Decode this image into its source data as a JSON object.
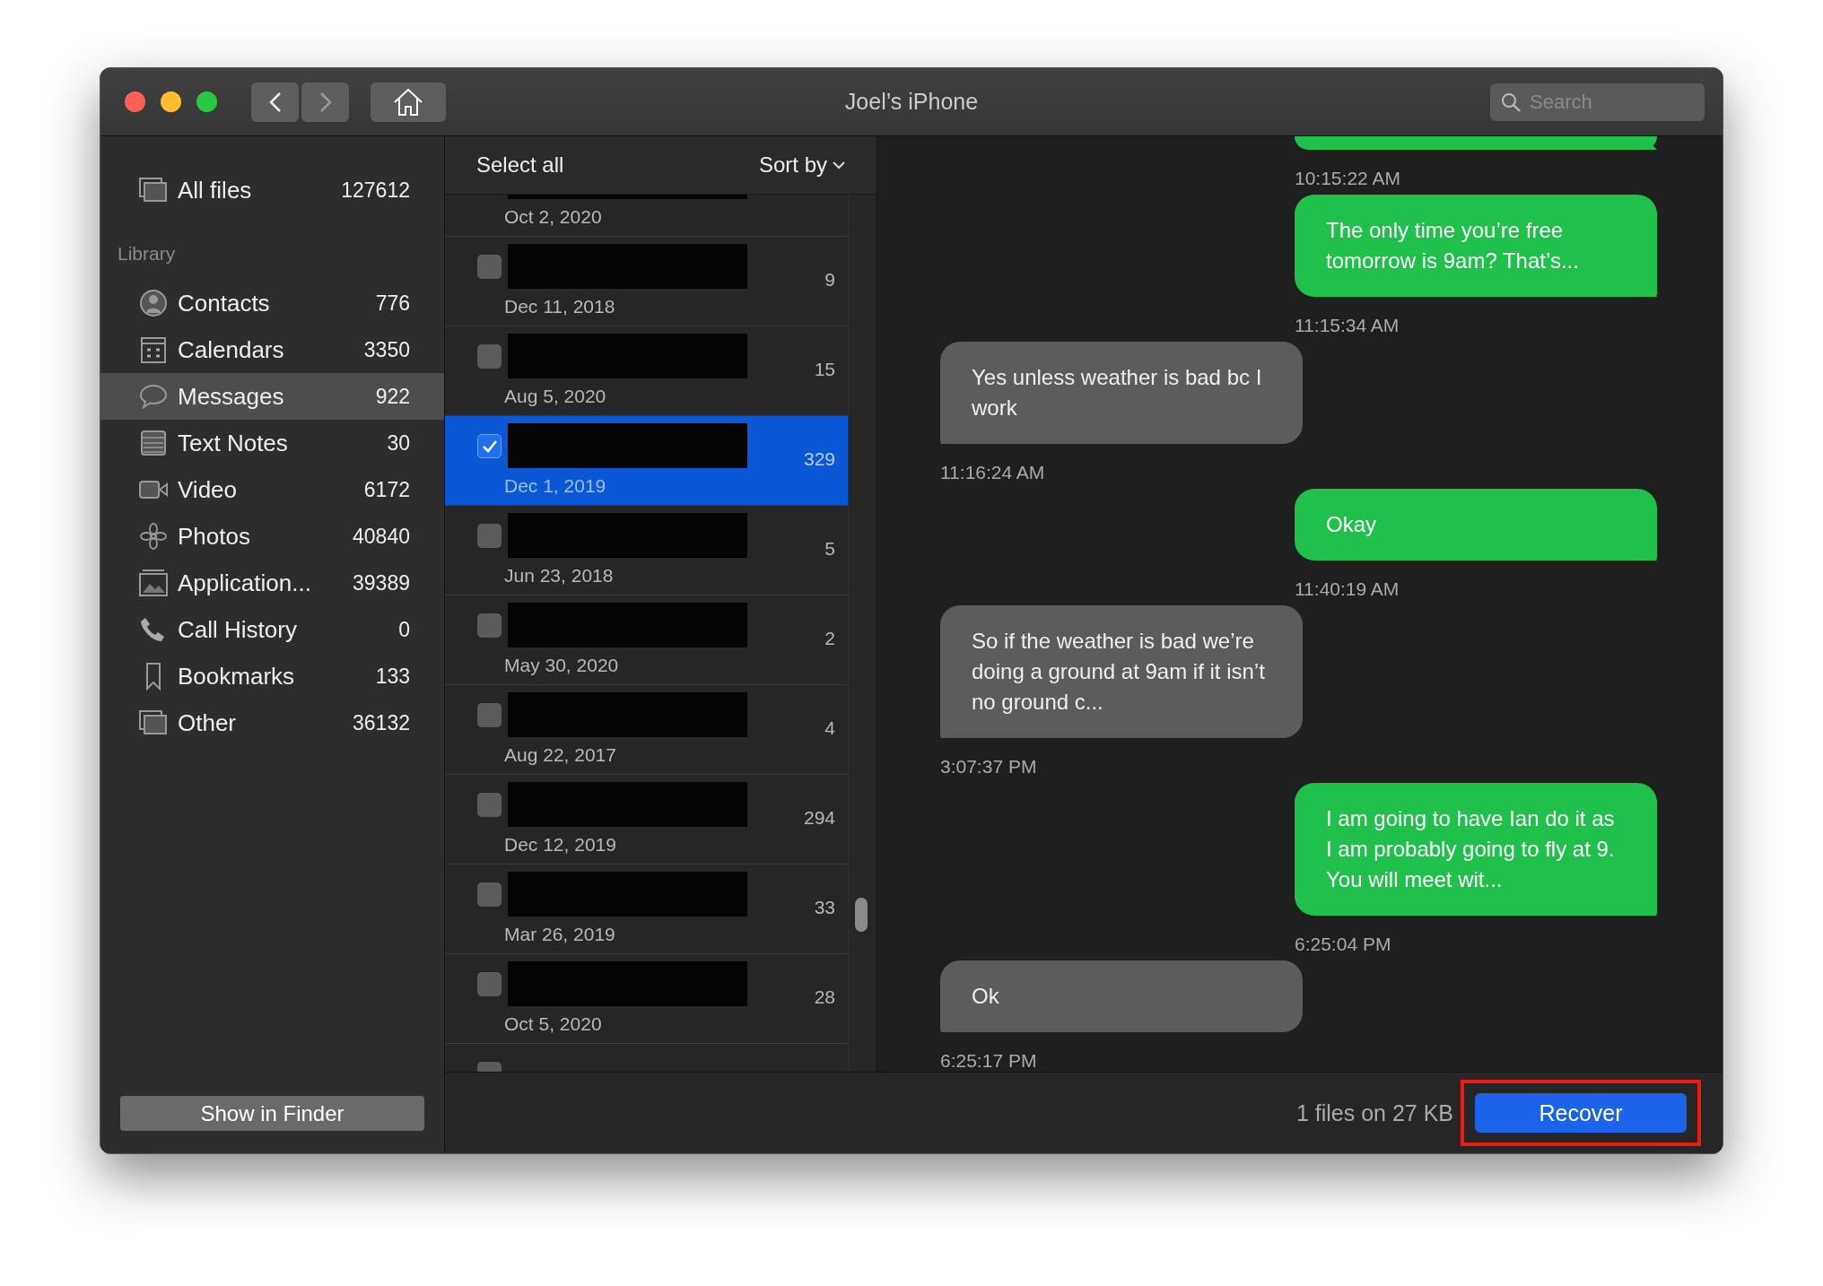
{
  "window": {
    "title": "Joel’s iPhone"
  },
  "toolbar": {
    "search": {
      "placeholder": "Search"
    }
  },
  "sidebar": {
    "all_files": {
      "label": "All files",
      "count": "127612",
      "selected": false
    },
    "section": "Library",
    "items": [
      {
        "label": "Contacts",
        "count": "776",
        "selected": false
      },
      {
        "label": "Calendars",
        "count": "3350",
        "selected": false
      },
      {
        "label": "Messages",
        "count": "922",
        "selected": true
      },
      {
        "label": "Text Notes",
        "count": "30",
        "selected": false
      },
      {
        "label": "Video",
        "count": "6172",
        "selected": false
      },
      {
        "label": "Photos",
        "count": "40840",
        "selected": false
      },
      {
        "label": "Application...",
        "count": "39389",
        "selected": false
      },
      {
        "label": "Call History",
        "count": "0",
        "selected": false
      },
      {
        "label": "Bookmarks",
        "count": "133",
        "selected": false
      },
      {
        "label": "Other",
        "count": "36132",
        "selected": false
      }
    ],
    "button": "Show in Finder"
  },
  "list": {
    "select_all": "Select all",
    "sort": "Sort by",
    "rows": [
      {
        "date": "Oct 2, 2020",
        "selected": false
      },
      {
        "date": "Dec 11, 2018",
        "count": "9",
        "checked": false,
        "selected": false
      },
      {
        "date": "Aug 5, 2020",
        "count": "15",
        "checked": false,
        "selected": false
      },
      {
        "date": "Dec 1, 2019",
        "count": "329",
        "checked": true,
        "selected": true
      },
      {
        "date": "Jun 23, 2018",
        "count": "5",
        "checked": false,
        "selected": false
      },
      {
        "date": "May 30, 2020",
        "count": "2",
        "checked": false,
        "selected": false
      },
      {
        "date": "Aug 22, 2017",
        "count": "4",
        "checked": false,
        "selected": false
      },
      {
        "date": "Dec 12, 2019",
        "count": "294",
        "checked": false,
        "selected": false
      },
      {
        "date": "Mar 26, 2019",
        "count": "33",
        "checked": false,
        "selected": false
      },
      {
        "date": "Oct 5, 2020",
        "count": "28",
        "checked": false,
        "selected": false
      },
      {
        "checked": false,
        "selected": false
      }
    ]
  },
  "messages": [
    {
      "kind": "sent",
      "time": "10:15:22 AM"
    },
    {
      "kind": "sent",
      "text": "The only time you’re free tomorrow is 9am? That’s...",
      "time": "11:15:34 AM"
    },
    {
      "kind": "received",
      "text": "Yes unless weather is bad bc I work",
      "time": "11:16:24 AM"
    },
    {
      "kind": "sent",
      "text": "Okay",
      "time": "11:40:19 AM"
    },
    {
      "kind": "received",
      "text": "So if the weather is bad we’re doing a ground at 9am if it isn’t no ground c...",
      "time": "3:07:37 PM"
    },
    {
      "kind": "sent",
      "text": "I am going to have Ian do it as I am probably going to fly at 9. You will meet wit...",
      "time": "6:25:04 PM"
    },
    {
      "kind": "received",
      "text": "Ok",
      "time": "6:25:17 PM"
    }
  ],
  "footer": {
    "summary": "1 files on 27 KB",
    "recover": {
      "label": "Recover",
      "highlighted": true
    }
  }
}
